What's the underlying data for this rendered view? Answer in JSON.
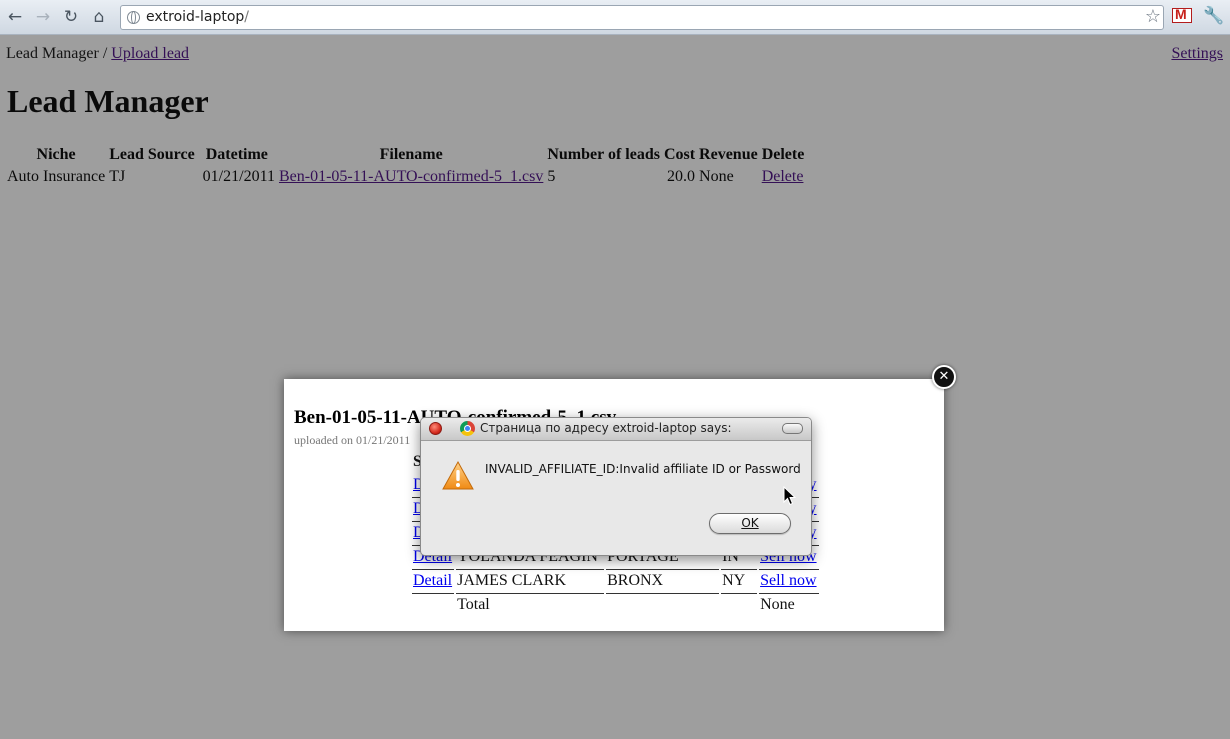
{
  "browser": {
    "url_host": "extroid-laptop",
    "url_path": "/",
    "back_icon": "back-arrow-icon",
    "forward_icon": "forward-arrow-icon",
    "reload_icon": "reload-icon",
    "home_icon": "home-icon"
  },
  "breadcrumb": {
    "root": "Lead Manager",
    "separator": " / ",
    "link": "Upload lead"
  },
  "settings_link": "Settings",
  "page_title": "Lead Manager",
  "leads_table": {
    "headers": [
      "Niche",
      "Lead Source",
      "Datetime",
      "Filename",
      "Number of leads",
      "Cost",
      "Revenue",
      "Delete"
    ],
    "rows": [
      {
        "niche": "Auto Insurance",
        "source": "TJ",
        "datetime": "01/21/2011",
        "filename": "Ben-01-05-11-AUTO-confirmed-5_1.csv",
        "count": "5",
        "cost": "20.0",
        "revenue": "None",
        "delete": "Delete"
      }
    ]
  },
  "modal": {
    "title": "Ben-01-05-11-AUTO-confirmed-5_1.csv",
    "subtitle": "uploaded on 01/21/2011",
    "header_first": "S",
    "rows": [
      {
        "detail": "D",
        "name": "",
        "city": "",
        "state": "",
        "action": "y"
      },
      {
        "detail": "D",
        "name": "",
        "city": "",
        "state": "",
        "action": "y"
      },
      {
        "detail": "D",
        "name": "",
        "city": "",
        "state": "",
        "action": "y"
      },
      {
        "detail": "Detail",
        "name": "YOLANDA FEAGIN",
        "city": "PORTAGE",
        "state": "IN",
        "action": "Sell now"
      },
      {
        "detail": "Detail",
        "name": "JAMES CLARK",
        "city": "BRONX",
        "state": "NY",
        "action": "Sell now"
      }
    ],
    "total_label": "Total",
    "total_value": "None"
  },
  "alert": {
    "title": "Страница по адресу extroid-laptop says:",
    "message": "INVALID_AFFILIATE_ID:Invalid affiliate ID or Password",
    "ok_label": "OK"
  }
}
